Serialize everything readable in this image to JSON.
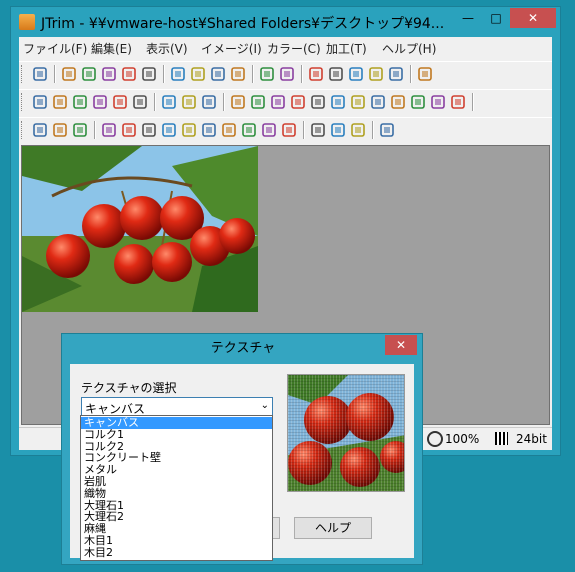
{
  "window": {
    "title": "JTrim - ¥¥vmware-host¥Shared Folders¥デスクトップ¥94...",
    "minimize_label": "—",
    "maximize_label": "□",
    "close_label": "✕"
  },
  "menu": [
    "ファイル(F)",
    "編集(E)",
    "表示(V)",
    "イメージ(I)",
    "カラー(C)",
    "加工(T)",
    "ヘルプ(H)"
  ],
  "toolbar_icons": {
    "row1": [
      "new-window-icon",
      "new-file-icon",
      "open-folder-icon",
      "save-icon",
      "print-icon",
      "print-preview-icon",
      "copy-icon",
      "paste-icon",
      "paste-new-icon",
      "batch-icon",
      "undo-icon",
      "redo-icon",
      "fit-icon",
      "text-icon",
      "align-icon",
      "grid-icon",
      "filmstrip-icon",
      "palette-icon"
    ],
    "row2": [
      "crop-icon",
      "resize-icon",
      "flip-horizontal-icon",
      "flip-vertical-icon",
      "mirror-icon",
      "frame-icon",
      "rotate-left-icon",
      "rotate-right-icon",
      "rotate-free-icon",
      "shadow-icon",
      "gradient-icon",
      "spot-icon",
      "noise-icon",
      "wave-icon",
      "mosaic-icon",
      "blur-icon",
      "sharpen-icon",
      "edge-icon",
      "pen-icon",
      "eraser-icon",
      "spiral-icon"
    ],
    "row3": [
      "grayscale-icon",
      "sepia-icon",
      "negative-icon",
      "sparkle-icon",
      "color-bar-icon",
      "palette-blue-icon",
      "image-icon",
      "gamma-icon",
      "color-wheel-icon",
      "checker-icon",
      "rgb-icon",
      "xor-icon",
      "brightness-icon",
      "zoom-menu-icon",
      "zoom-in-icon",
      "zoom-out-icon",
      "eyedropper-icon"
    ]
  },
  "status": {
    "zoom": "100%",
    "depth": "24bit"
  },
  "dialog": {
    "title": "テクスチャ",
    "close_label": "✕",
    "select_label": "テクスチャの選択",
    "selected_value": "キャンバス",
    "help_button": "ヘルプ"
  },
  "dropdown_options": [
    "キャンバス",
    "コルク1",
    "コルク2",
    "コンクリート壁",
    "メタル",
    "岩肌",
    "織物",
    "大理石1",
    "大理石2",
    "麻縄",
    "木目1",
    "木目2"
  ],
  "colors": {
    "desktop": "#1a8fa8",
    "titlebar": "#2aa2bd",
    "close_button": "#c75050",
    "selection": "#3399ff"
  }
}
